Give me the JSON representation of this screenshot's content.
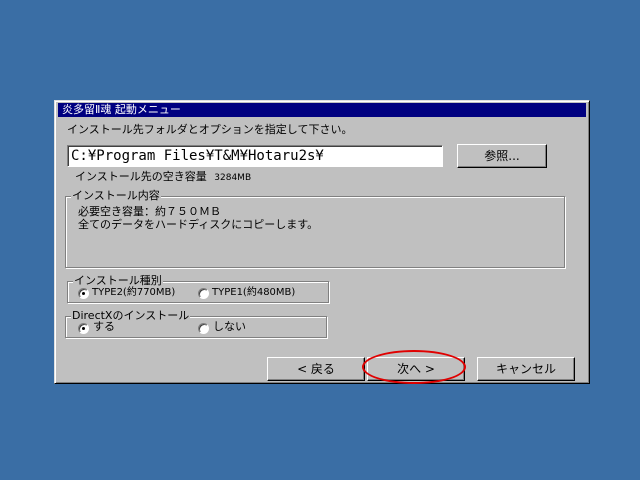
{
  "window": {
    "title": "炎多留Ⅱ魂 起動メニュー"
  },
  "instruction": "インストール先フォルダとオプションを指定して下さい。",
  "install_path": {
    "value": "C:¥Program Files¥T&M¥Hotaru2s¥",
    "browse_label": "参照..."
  },
  "free_space": {
    "label": "インストール先の空き容量",
    "value": "3284MB"
  },
  "install_contents": {
    "legend": "インストール内容",
    "line1": "必要空き容量：約７５０ＭＢ",
    "line2": "全てのデータをハードディスクにコピーします。"
  },
  "install_type": {
    "legend": "インストール種別",
    "options": [
      {
        "label": "TYPE2(約770MB)",
        "selected": true
      },
      {
        "label": "TYPE1(約480MB)",
        "selected": false
      }
    ]
  },
  "directx": {
    "legend": "DirectXのインストール",
    "options": [
      {
        "label": "する",
        "selected": true
      },
      {
        "label": "しない",
        "selected": false
      }
    ]
  },
  "buttons": {
    "back": "< 戻る",
    "next": "次へ >",
    "cancel": "キャンセル"
  },
  "colors": {
    "desktop": "#3a6ea5",
    "titlebar": "#000080",
    "dialog": "#c0c0c0",
    "highlight_annotation": "#e00000"
  }
}
